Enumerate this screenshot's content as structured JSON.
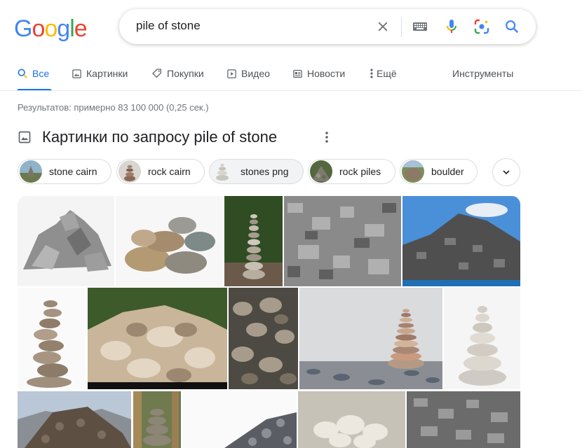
{
  "logo": {
    "letters": [
      "G",
      "o",
      "o",
      "g",
      "l",
      "e"
    ],
    "colors": [
      "#4285f4",
      "#ea4335",
      "#fbbc05",
      "#4285f4",
      "#34a853",
      "#ea4335"
    ]
  },
  "search": {
    "query": "pile of stone"
  },
  "tabs": [
    {
      "label": "Все",
      "icon": "search-icon",
      "active": true
    },
    {
      "label": "Картинки",
      "icon": "image-icon"
    },
    {
      "label": "Покупки",
      "icon": "tag-icon"
    },
    {
      "label": "Видео",
      "icon": "play-icon"
    },
    {
      "label": "Новости",
      "icon": "news-icon"
    },
    {
      "label": "Ещё",
      "icon": "more-vert-icon"
    }
  ],
  "tools_label": "Инструменты",
  "result_stats": "Результатов: примерно 83 100 000 (0,25 сек.)",
  "images_section": {
    "title": "Картинки по запросу pile of stone"
  },
  "chips": [
    {
      "label": "stone cairn"
    },
    {
      "label": "rock cairn"
    },
    {
      "label": "stones png"
    },
    {
      "label": "rock piles"
    },
    {
      "label": "boulder"
    }
  ],
  "colors": {
    "accent": "#1a73e8",
    "text_secondary": "#4d5156",
    "stats": "#70757a"
  }
}
